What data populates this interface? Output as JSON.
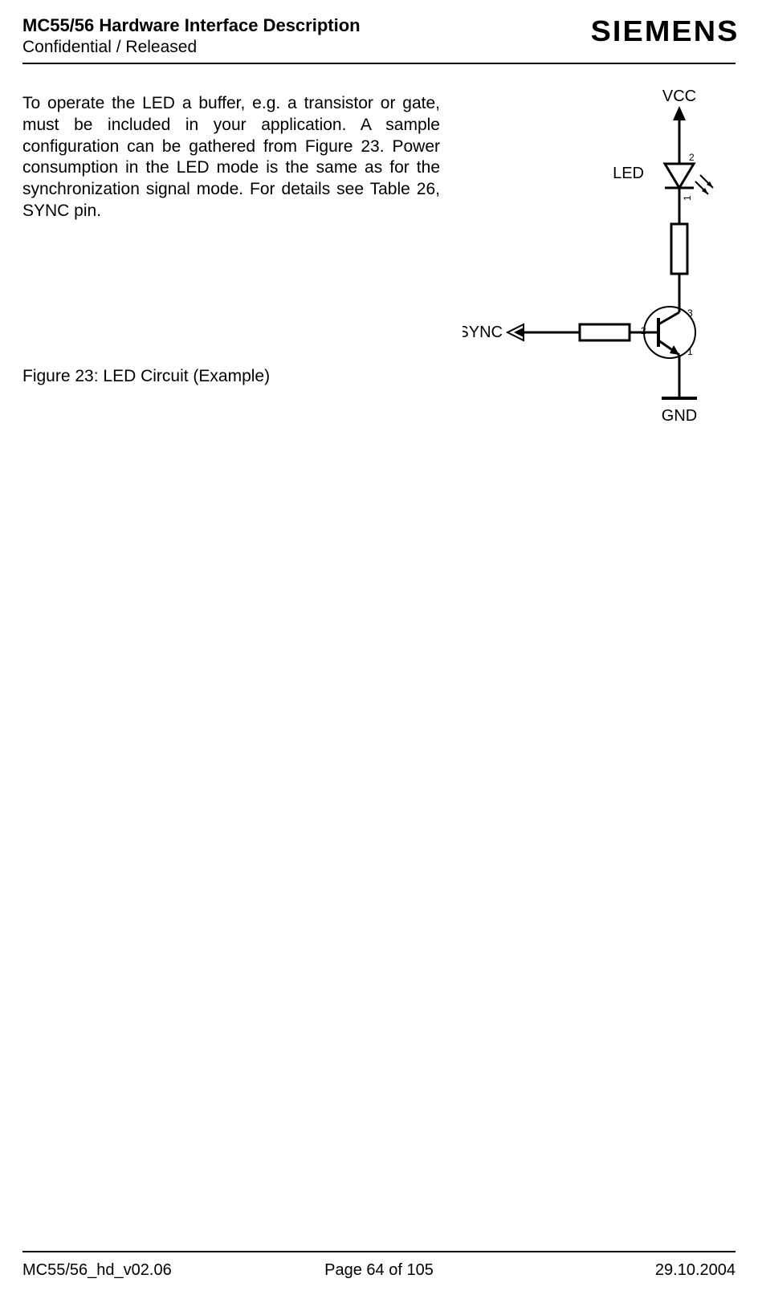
{
  "header": {
    "title": "MC55/56 Hardware Interface Description",
    "subtitle": "Confidential / Released",
    "logo": "SIEMENS"
  },
  "body": {
    "paragraph": "To operate the LED a buffer, e.g. a transistor or gate, must be included in your application. A sample configuration can be gathered from Figure 23. Power consumption in the LED mode is the same as for the synchronization signal mode. For details see Table 26, SYNC pin."
  },
  "figure": {
    "caption": "Figure 23: LED Circuit (Example)",
    "labels": {
      "vcc": "VCC",
      "led": "LED",
      "sync": "SYNC",
      "gnd": "GND",
      "pin1": "1",
      "pin2": "2",
      "pin3": "3",
      "t_base": "2",
      "t_col": "3",
      "t_emit": "1"
    }
  },
  "footer": {
    "left": "MC55/56_hd_v02.06",
    "center": "Page 64 of 105",
    "right": "29.10.2004"
  }
}
